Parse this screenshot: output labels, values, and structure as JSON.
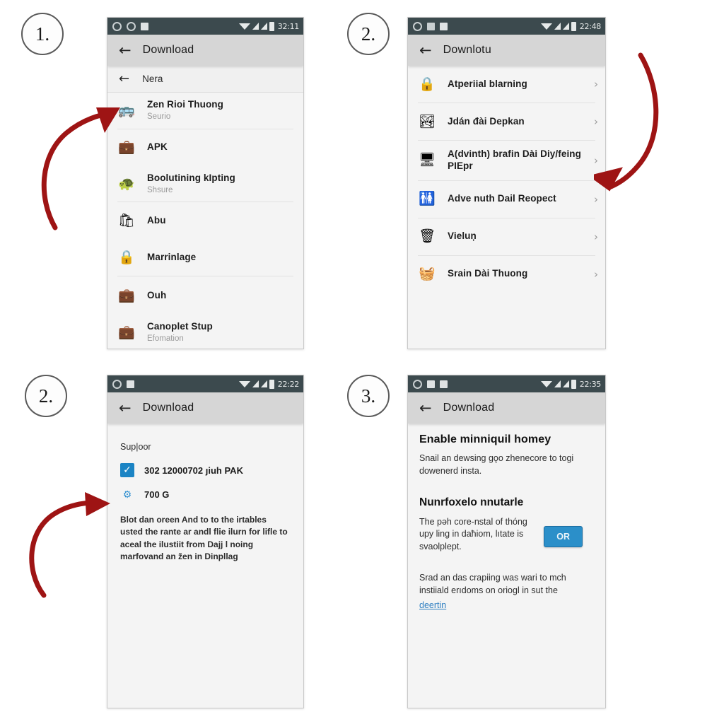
{
  "meta": {
    "accent_red": "#9e1414",
    "accent_blue": "#2b8fc9",
    "statusbar_bg": "#3c4a4e",
    "appbar_bg": "#d6d6d6"
  },
  "steps": [
    {
      "label": "1."
    },
    {
      "label": "2."
    },
    {
      "label": "2."
    },
    {
      "label": "3."
    }
  ],
  "panel1": {
    "status": {
      "time": "32:11"
    },
    "appbar": {
      "title": "Download",
      "back": "←"
    },
    "subbar": {
      "title": "Nera",
      "back": "←"
    },
    "rows": [
      {
        "icon": "🚌",
        "title": "Zen Rioi Thuong",
        "sub": "Seurio"
      },
      {
        "icon": "💼",
        "title": "APK",
        "sub": ""
      },
      {
        "icon": "🐢",
        "title": "Boolutining kIpting",
        "sub": "Shsure"
      },
      {
        "icon": "🛍",
        "title": "Abu",
        "sub": ""
      },
      {
        "icon": "🔒",
        "title": "Marrinlage",
        "sub": ""
      },
      {
        "icon": "💼",
        "title": "Ouh",
        "sub": ""
      },
      {
        "icon": "💼",
        "title": "Canoplet Stup",
        "sub": "Efomation"
      }
    ]
  },
  "panel2": {
    "status": {
      "time": "22:48"
    },
    "appbar": {
      "title": "Downlotu",
      "back": "←"
    },
    "rows": [
      {
        "icon": "🔒",
        "title": "Atperiial blarning",
        "sub": "",
        "chevron": "›"
      },
      {
        "icon": "🏞",
        "title": "Jdán đài Depkan",
        "sub": "",
        "chevron": "›"
      },
      {
        "icon": "🖥",
        "title": "A(dvinth) brafin Dài Diy/feing PIEpr",
        "sub": "",
        "chevron": "›"
      },
      {
        "icon": "🚻",
        "title": "Adve nuth Dail Reopect",
        "sub": "",
        "chevron": "›"
      },
      {
        "icon": "🗑",
        "title": "Vieluņ",
        "sub": "",
        "chevron": "›"
      },
      {
        "icon": "🧺",
        "title": "Srain Dài Thuong",
        "sub": "",
        "chevron": "›"
      }
    ]
  },
  "panel3": {
    "status": {
      "time": "22:22"
    },
    "appbar": {
      "title": "Download",
      "back": "←"
    },
    "section_label": "Sup|oor",
    "checkbox": {
      "checked": true,
      "glyph": "✓",
      "label": "302 12000702 ȷiuh PAK"
    },
    "item": {
      "icon": "⚙",
      "label": "700 G"
    },
    "paragraph": "Blot dan oreen And to to the irtables usted the rante ar andl flie ilurn for lifle to aceal the ilustiit from Dajj l noing marfovand an žen in Dinpllag"
  },
  "panel4": {
    "status": {
      "time": "22:35"
    },
    "appbar": {
      "title": "Download",
      "back": "←"
    },
    "heading1": "Enable minniquil homey",
    "para1": "Snail an dewsing ɡǫo zhenecore to togi dowenerd insta.",
    "heading2": "Nunrfoxelo nnutarle",
    "para2": "The pəh core-nstal of thóng upy ling in daħiom, lıtate is svaolplept.",
    "ok_button": "OR",
    "para3": "Srad an das crapiing was wari to mch instiiald erıdoms on orioɡl in sut the",
    "link": "deertin"
  }
}
